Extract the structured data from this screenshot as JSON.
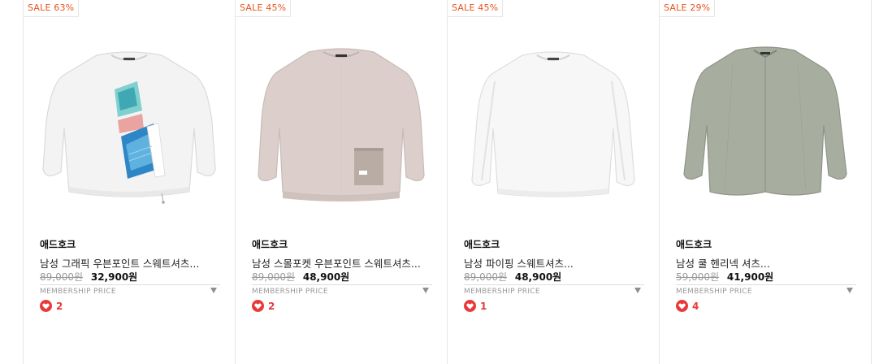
{
  "products": [
    {
      "badge": "SALE 63%",
      "brand": "애드호크",
      "name": "남성 그래픽 우븐포인트 스웨트셔츠...",
      "original_price": "89,000원",
      "sale_price": "32,900원",
      "membership_label": "MEMBERSHIP PRICE",
      "likes": "2",
      "image": "white-graphic-sweatshirt"
    },
    {
      "badge": "SALE 45%",
      "brand": "애드호크",
      "name": "남성 스몰포켓 우븐포인트 스웨트셔츠...",
      "original_price": "89,000원",
      "sale_price": "48,900원",
      "membership_label": "MEMBERSHIP PRICE",
      "likes": "2",
      "image": "pink-pocket-sweatshirt"
    },
    {
      "badge": "SALE 45%",
      "brand": "애드호크",
      "name": "남성 파이핑 스웨트셔츠...",
      "original_price": "89,000원",
      "sale_price": "48,900원",
      "membership_label": "MEMBERSHIP PRICE",
      "likes": "1",
      "image": "white-piping-sweatshirt"
    },
    {
      "badge": "SALE 29%",
      "brand": "애드호크",
      "name": "남성 쿨 헨리넥 셔츠...",
      "original_price": "59,000원",
      "sale_price": "41,900원",
      "membership_label": "MEMBERSHIP PRICE",
      "likes": "4",
      "image": "sage-henley-shirt"
    }
  ],
  "colors": {
    "sale_badge": "#e8541e",
    "like": "#e83a3a",
    "border": "#e6e6e6"
  }
}
